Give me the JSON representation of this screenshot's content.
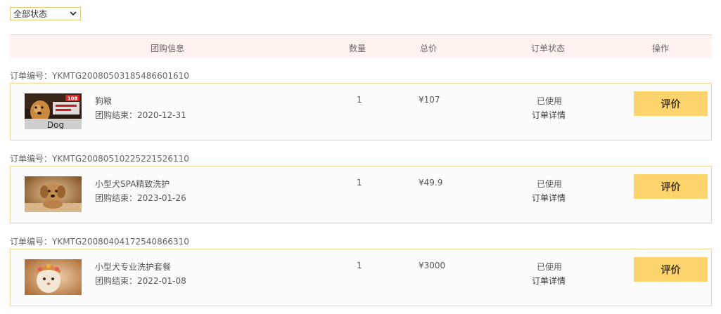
{
  "filter": {
    "selected": "全部状态"
  },
  "table": {
    "headers": {
      "info": "团购信息",
      "qty": "数量",
      "total": "总价",
      "status": "订单状态",
      "action": "操作"
    }
  },
  "orders": [
    {
      "order_no": "订单编号：YKMTG20080503185486601610",
      "name": "狗粮",
      "end_label": "团购结束：",
      "end_date": "2020-12-31",
      "qty": "1",
      "price": "¥107",
      "status": "已使用",
      "detail": "订单详情",
      "action": "评价",
      "thumb_badge": "108",
      "thumb_text": "Dog"
    },
    {
      "order_no": "订单编号：YKMTG20080510225221526110",
      "name": "小型犬SPA精致洗护",
      "end_label": "团购结束：",
      "end_date": "2023-01-26",
      "qty": "1",
      "price": "¥49.9",
      "status": "已使用",
      "detail": "订单详情",
      "action": "评价"
    },
    {
      "order_no": "订单编号：YKMTG20080404172540866310",
      "name": "小型犬专业洗护套餐",
      "end_label": "团购结束：",
      "end_date": "2022-01-08",
      "qty": "1",
      "price": "¥3000",
      "status": "已使用",
      "detail": "订单详情",
      "action": "评价"
    }
  ]
}
